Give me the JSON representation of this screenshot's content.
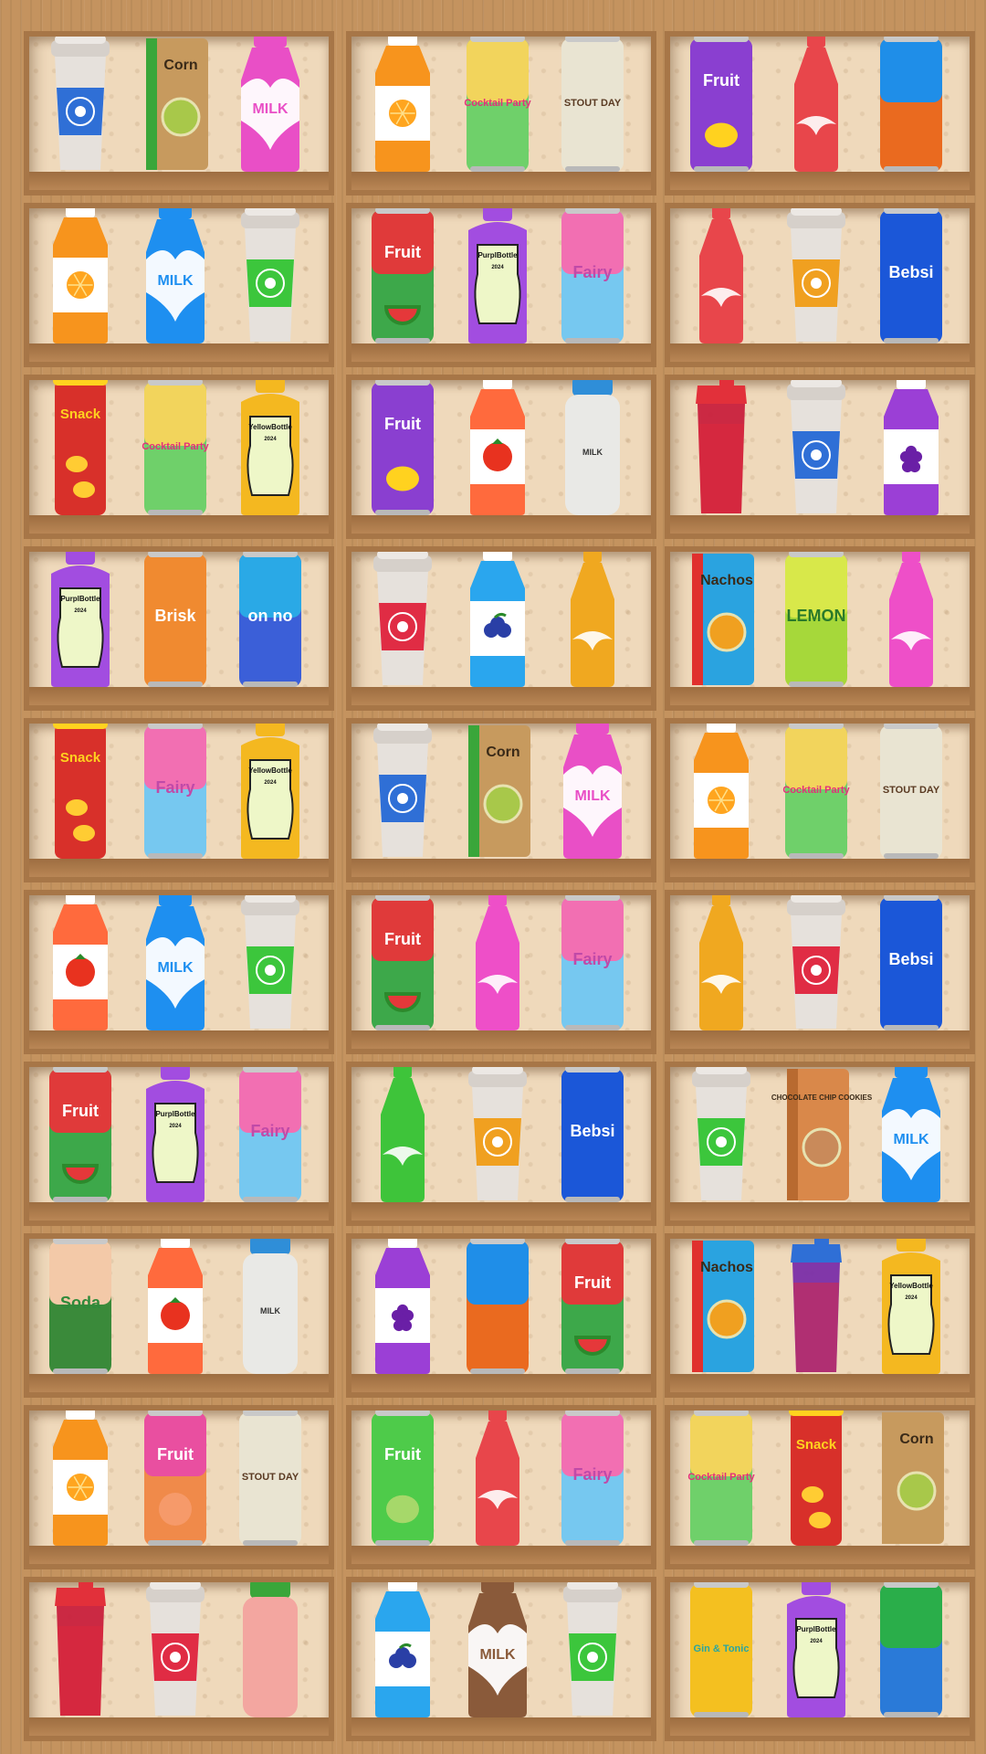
{
  "game": {
    "title": ""
  },
  "shelves": [
    {
      "items": [
        {
          "kind": "cup",
          "sleeve": "#2f6fd6",
          "label": ""
        },
        {
          "kind": "bag",
          "color": "#c79a5e",
          "side": "#3aa63a",
          "label": "Corn",
          "seal": "#a8c84a"
        },
        {
          "kind": "milk",
          "color": "#e94fc6",
          "label": "MILK"
        },
        {
          "kind": "juice",
          "color": "#f7941d",
          "fruit": "orange",
          "label": ""
        },
        {
          "kind": "can",
          "top": "#f2d45c",
          "bottom": "#6fd06a",
          "label": "Cocktail Party",
          "textColor": "#e2307a"
        },
        {
          "kind": "can",
          "top": "#e9e4d2",
          "bottom": "#e9e4d2",
          "label": "STOUT DAY",
          "textColor": "#5a3a22"
        },
        {
          "kind": "can",
          "top": "#8a3fd0",
          "bottom": "#8a3fd0",
          "label": "Fruit",
          "textColor": "#ffffff",
          "fruit": "lemon"
        },
        {
          "kind": "soda",
          "color": "#e8464b",
          "label": ""
        },
        {
          "kind": "can",
          "top": "#1f8ee8",
          "bottom": "#ea6a1f",
          "label": "",
          "textColor": "#ffffff"
        }
      ]
    },
    {
      "items": [
        {
          "kind": "juice",
          "color": "#f7941d",
          "fruit": "orange",
          "label": ""
        },
        {
          "kind": "milk",
          "color": "#1e8ff0",
          "label": "MILK"
        },
        {
          "kind": "cup",
          "sleeve": "#3cc63c",
          "label": ""
        },
        {
          "kind": "can",
          "top": "#e03a3a",
          "bottom": "#3da84a",
          "label": "Fruit",
          "textColor": "#ffffff",
          "fruit": "watermelon"
        },
        {
          "kind": "flask",
          "color": "#a24de0",
          "label": "PurplBottle",
          "year": "2024"
        },
        {
          "kind": "can",
          "top": "#f26fb2",
          "bottom": "#76c8f0",
          "label": "Fairy",
          "textColor": "#c04aa8"
        },
        {
          "kind": "soda",
          "color": "#e8464b",
          "label": ""
        },
        {
          "kind": "cup",
          "sleeve": "#f0a020",
          "label": ""
        },
        {
          "kind": "can",
          "top": "#1b57d8",
          "bottom": "#1b57d8",
          "label": "Bebsi",
          "textColor": "#ffffff"
        }
      ]
    },
    {
      "items": [
        {
          "kind": "tube",
          "color": "#d8302a",
          "label": "Snack"
        },
        {
          "kind": "can",
          "top": "#f2d45c",
          "bottom": "#6fd06a",
          "label": "Cocktail Party",
          "textColor": "#e2307a"
        },
        {
          "kind": "flask",
          "color": "#f4b820",
          "label": "YellowBottle",
          "year": "2024"
        },
        {
          "kind": "can",
          "top": "#8a3fd0",
          "bottom": "#8a3fd0",
          "label": "Fruit",
          "textColor": "#ffffff",
          "fruit": "lemon"
        },
        {
          "kind": "juice",
          "color": "#ff6a3d",
          "fruit": "tomato",
          "label": ""
        },
        {
          "kind": "jar",
          "color": "#e9e9e6",
          "lid": "#2f8ed8",
          "label": "MILK"
        },
        {
          "kind": "shaker",
          "color": "#c8203c",
          "lid": "#e2303a",
          "label": ""
        },
        {
          "kind": "cup",
          "sleeve": "#2f6fd6",
          "label": ""
        },
        {
          "kind": "juice",
          "color": "#9b3fd6",
          "fruit": "grape",
          "label": ""
        }
      ]
    },
    {
      "items": [
        {
          "kind": "flask",
          "color": "#a24de0",
          "label": "PurplBottle",
          "year": "2024"
        },
        {
          "kind": "can",
          "top": "#f08a30",
          "bottom": "#f08a30",
          "label": "Brisk",
          "textColor": "#ffffff"
        },
        {
          "kind": "can",
          "top": "#2aa9e6",
          "bottom": "#3b5fd8",
          "label": "on no",
          "textColor": "#ffffff"
        },
        {
          "kind": "cup",
          "sleeve": "#e02c44",
          "label": ""
        },
        {
          "kind": "juice",
          "color": "#2aa6ee",
          "fruit": "blueberry",
          "label": ""
        },
        {
          "kind": "soda",
          "color": "#f0a820",
          "label": ""
        },
        {
          "kind": "bag",
          "color": "#2aa3e0",
          "side": "#e0302e",
          "label": "Nachos",
          "seal": "#f0a020"
        },
        {
          "kind": "can",
          "top": "#d8e84a",
          "bottom": "#a6d83a",
          "label": "LEMON",
          "textColor": "#2a7a2a"
        },
        {
          "kind": "soda",
          "color": "#ee4fc8",
          "label": ""
        }
      ]
    },
    {
      "items": [
        {
          "kind": "tube",
          "color": "#d8302a",
          "label": "Snack"
        },
        {
          "kind": "can",
          "top": "#f26fb2",
          "bottom": "#76c8f0",
          "label": "Fairy",
          "textColor": "#c04aa8"
        },
        {
          "kind": "flask",
          "color": "#f4b820",
          "label": "YellowBottle",
          "year": "2024"
        },
        {
          "kind": "cup",
          "sleeve": "#2f6fd6",
          "label": ""
        },
        {
          "kind": "bag",
          "color": "#c79a5e",
          "side": "#3aa63a",
          "label": "Corn",
          "seal": "#a8c84a"
        },
        {
          "kind": "milk",
          "color": "#e94fc6",
          "label": "MILK"
        },
        {
          "kind": "juice",
          "color": "#f7941d",
          "fruit": "orange",
          "label": ""
        },
        {
          "kind": "can",
          "top": "#f2d45c",
          "bottom": "#6fd06a",
          "label": "Cocktail Party",
          "textColor": "#e2307a"
        },
        {
          "kind": "can",
          "top": "#e9e4d2",
          "bottom": "#e9e4d2",
          "label": "STOUT DAY",
          "textColor": "#5a3a22"
        }
      ]
    },
    {
      "items": [
        {
          "kind": "juice",
          "color": "#ff6a3d",
          "fruit": "tomato",
          "label": ""
        },
        {
          "kind": "milk",
          "color": "#1e8ff0",
          "label": "MILK"
        },
        {
          "kind": "cup",
          "sleeve": "#3cc63c",
          "label": ""
        },
        {
          "kind": "can",
          "top": "#e03a3a",
          "bottom": "#3da84a",
          "label": "Fruit",
          "textColor": "#ffffff",
          "fruit": "watermelon"
        },
        {
          "kind": "soda",
          "color": "#ee4fc8",
          "label": ""
        },
        {
          "kind": "can",
          "top": "#f26fb2",
          "bottom": "#76c8f0",
          "label": "Fairy",
          "textColor": "#c04aa8"
        },
        {
          "kind": "soda",
          "color": "#f0a820",
          "label": ""
        },
        {
          "kind": "cup",
          "sleeve": "#e02c44",
          "label": ""
        },
        {
          "kind": "can",
          "top": "#1b57d8",
          "bottom": "#1b57d8",
          "label": "Bebsi",
          "textColor": "#ffffff"
        }
      ]
    },
    {
      "items": [
        {
          "kind": "can",
          "top": "#e03a3a",
          "bottom": "#3da84a",
          "label": "Fruit",
          "textColor": "#ffffff",
          "fruit": "watermelon"
        },
        {
          "kind": "flask",
          "color": "#a24de0",
          "label": "PurplBottle",
          "year": "2024"
        },
        {
          "kind": "can",
          "top": "#f26fb2",
          "bottom": "#76c8f0",
          "label": "Fairy",
          "textColor": "#c04aa8"
        },
        {
          "kind": "soda",
          "color": "#3ec43a",
          "label": ""
        },
        {
          "kind": "cup",
          "sleeve": "#f0a020",
          "label": ""
        },
        {
          "kind": "can",
          "top": "#1b57d8",
          "bottom": "#1b57d8",
          "label": "Bebsi",
          "textColor": "#ffffff"
        },
        {
          "kind": "cup",
          "sleeve": "#3cc63c",
          "label": ""
        },
        {
          "kind": "bag",
          "color": "#d9884a",
          "side": "#b86a30",
          "label": "CHOCOLATE CHIP COOKIES",
          "seal": "#c98a5a"
        },
        {
          "kind": "milk",
          "color": "#1e8ff0",
          "label": "MILK"
        }
      ]
    },
    {
      "items": [
        {
          "kind": "can",
          "top": "#f3c9a8",
          "bottom": "#3a8a3a",
          "label": "Soda",
          "textColor": "#2f8a3a"
        },
        {
          "kind": "juice",
          "color": "#ff6a3d",
          "fruit": "tomato",
          "label": ""
        },
        {
          "kind": "jar",
          "color": "#e9e9e6",
          "lid": "#2f8ed8",
          "label": "MILK"
        },
        {
          "kind": "juice",
          "color": "#9b3fd6",
          "fruit": "grape",
          "label": ""
        },
        {
          "kind": "can",
          "top": "#1f8ee8",
          "bottom": "#ea6a1f",
          "label": "",
          "textColor": "#ffffff"
        },
        {
          "kind": "can",
          "top": "#e03a3a",
          "bottom": "#3da84a",
          "label": "Fruit",
          "textColor": "#ffffff",
          "fruit": "watermelon"
        },
        {
          "kind": "bag",
          "color": "#2aa3e0",
          "side": "#e0302e",
          "label": "Nachos",
          "seal": "#f0a020"
        },
        {
          "kind": "shaker",
          "color": "#7a2ea8",
          "lid": "#2f6fd6",
          "label": ""
        },
        {
          "kind": "flask",
          "color": "#f4b820",
          "label": "YellowBottle",
          "year": "2024"
        }
      ]
    },
    {
      "items": [
        {
          "kind": "juice",
          "color": "#f7941d",
          "fruit": "orange",
          "label": ""
        },
        {
          "kind": "can",
          "top": "#e94fa0",
          "bottom": "#f08a4a",
          "label": "Fruit",
          "textColor": "#ffffff",
          "fruit": "peach"
        },
        {
          "kind": "can",
          "top": "#e9e4d2",
          "bottom": "#e9e4d2",
          "label": "STOUT DAY",
          "textColor": "#5a3a22"
        },
        {
          "kind": "can",
          "top": "#4ecb4a",
          "bottom": "#4ecb4a",
          "label": "Fruit",
          "textColor": "#ffffff",
          "fruit": "guava"
        },
        {
          "kind": "soda",
          "color": "#e8464b",
          "label": ""
        },
        {
          "kind": "can",
          "top": "#f26fb2",
          "bottom": "#76c8f0",
          "label": "Fairy",
          "textColor": "#c04aa8"
        },
        {
          "kind": "can",
          "top": "#f2d45c",
          "bottom": "#6fd06a",
          "label": "Cocktail Party",
          "textColor": "#e2307a"
        },
        {
          "kind": "tube",
          "color": "#d8302a",
          "label": "Snack"
        },
        {
          "kind": "bag",
          "color": "#c79a5e",
          "side": "#c79a5e",
          "label": "Corn",
          "seal": "#a8c84a"
        }
      ]
    },
    {
      "items": [
        {
          "kind": "shaker",
          "color": "#c8203c",
          "lid": "#e2303a",
          "label": ""
        },
        {
          "kind": "cup",
          "sleeve": "#e02c44",
          "label": ""
        },
        {
          "kind": "jar",
          "color": "#f3a6a0",
          "lid": "#3aa63a",
          "label": ""
        },
        {
          "kind": "juice",
          "color": "#2aa6ee",
          "fruit": "blueberry",
          "label": ""
        },
        {
          "kind": "milk",
          "color": "#8a5a3a",
          "label": "MILK"
        },
        {
          "kind": "cup",
          "sleeve": "#3cc63c",
          "label": ""
        },
        {
          "kind": "can",
          "top": "#f4c020",
          "bottom": "#f4c020",
          "label": "Gin & Tonic",
          "textColor": "#2aa6a0"
        },
        {
          "kind": "flask",
          "color": "#a24de0",
          "label": "PurplBottle",
          "year": "2024"
        },
        {
          "kind": "can",
          "top": "#2aae4a",
          "bottom": "#2a7ad8",
          "label": "",
          "textColor": "#ffffff"
        }
      ]
    }
  ]
}
